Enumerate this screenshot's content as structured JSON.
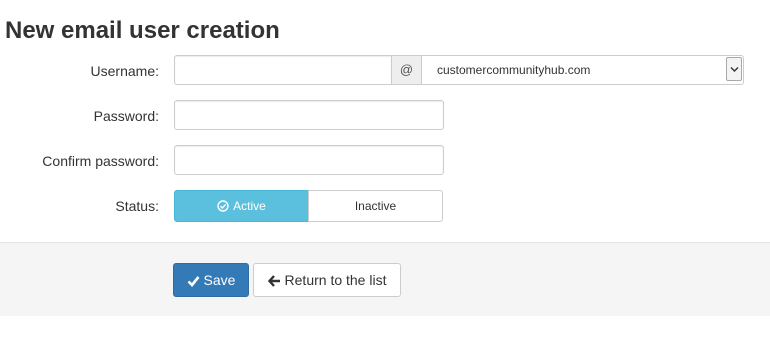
{
  "page": {
    "title": "New email user creation"
  },
  "form": {
    "username": {
      "label": "Username:",
      "value": "",
      "at_symbol": "@",
      "domain_selected": "customercommunityhub.com"
    },
    "password": {
      "label": "Password:",
      "value": ""
    },
    "confirm_password": {
      "label": "Confirm password:",
      "value": ""
    },
    "status": {
      "label": "Status:",
      "options": [
        {
          "label": "Active",
          "selected": true
        },
        {
          "label": "Inactive",
          "selected": false
        }
      ]
    }
  },
  "actions": {
    "save_label": "Save",
    "return_label": "Return to the list"
  },
  "icons": {
    "status_active": "check-circle-icon",
    "save": "checkmark-icon",
    "return": "arrow-left-icon",
    "select": "chevron-down-icon"
  },
  "colors": {
    "active_status": "#5bc0de",
    "primary_button": "#337ab7",
    "footer_background": "#f5f5f5"
  }
}
